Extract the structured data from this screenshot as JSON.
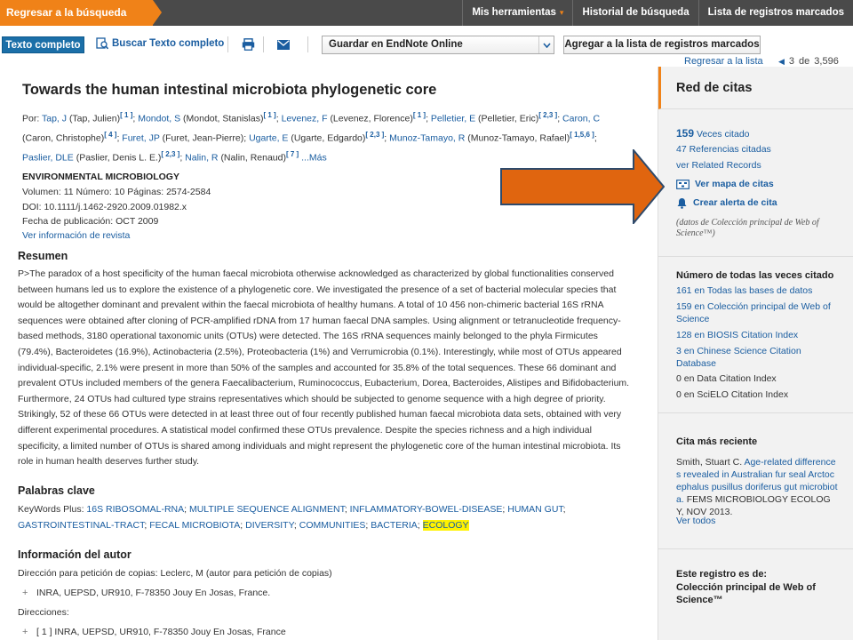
{
  "topbar": {
    "back_label": "Regresar a la búsqueda",
    "nav": [
      {
        "label": "Mis herramientas",
        "caret": "▾"
      },
      {
        "label": "Historial de búsqueda"
      },
      {
        "label": "Lista de registros marcados"
      }
    ]
  },
  "toolbar": {
    "fulltext_label": "Texto completo",
    "find_fulltext_label": "Buscar Texto completo",
    "print_icon": "print-icon",
    "email_icon": "email-icon",
    "endnote_value": "Guardar en EndNote Online",
    "add_marked_label": "Agregar a la lista de registros marcados"
  },
  "navline": {
    "return_label": "Regresar a la lista",
    "current": "3",
    "of": "de",
    "total": "3,596"
  },
  "record": {
    "title": "Towards the human intestinal microbiota phylogenetic core",
    "by_label": "Por:",
    "authors_line1": [
      {
        "short": "Tap, J",
        "full": "(Tap, Julien)",
        "ref": "[ 1 ]"
      },
      {
        "short": "Mondot, S",
        "full": "(Mondot, Stanislas)",
        "ref": "[ 1 ]"
      },
      {
        "short": "Levenez, F",
        "full": "(Levenez, Florence)",
        "ref": "[ 1 ]"
      },
      {
        "short": "Pelletier, E",
        "full": "(Pelletier, Eric)",
        "ref": "[ 2,3 ]"
      },
      {
        "short": "Caron, C",
        "full": "",
        "ref": ""
      }
    ],
    "authors_line2_prefix": "(Caron, Christophe)",
    "authors_line2_prefix_ref": "[ 4 ]",
    "authors_line2": [
      {
        "short": "Furet, JP",
        "full": "(Furet, Jean-Pierre)",
        "ref": ""
      },
      {
        "short": "Ugarte, E",
        "full": "(Ugarte, Edgardo)",
        "ref": "[ 2,3 ]"
      },
      {
        "short": "Munoz-Tamayo, R",
        "full": "(Munoz-Tamayo, Rafael)",
        "ref": "[ 1,5,6 ]"
      }
    ],
    "authors_line3": [
      {
        "short": "Paslier, DLE",
        "full": "(Paslier, Denis L. E.)",
        "ref": "[ 2,3 ]"
      },
      {
        "short": "Nalin, R",
        "full": "(Nalin, Renaud)",
        "ref": "[ 7 ]"
      }
    ],
    "more_label": "...Más",
    "journal": "ENVIRONMENTAL MICROBIOLOGY",
    "volume_line": "Volumen:  11   Número:  10   Páginas:  2574-2584",
    "doi_line": "DOI:  10.1111/j.1462-2920.2009.01982.x",
    "pubdate_line": "Fecha de publicación:  OCT 2009",
    "journal_info_link": "Ver información de revista",
    "abstract_heading": "Resumen",
    "abstract": "P>The paradox of a host specificity of the human faecal microbiota otherwise acknowledged as characterized by global functionalities conserved between humans led us to explore the existence of a phylogenetic core. We investigated the presence of a set of bacterial molecular species that would be altogether dominant and prevalent within the faecal microbiota of healthy humans. A total of 10 456 non-chimeric bacterial 16S rRNA sequences were obtained after cloning of PCR-amplified rDNA from 17 human faecal DNA samples. Using alignment or tetranucleotide frequency-based methods, 3180 operational taxonomic units (OTUs) were detected. The 16S rRNA sequences mainly belonged to the phyla Firmicutes (79.4%), Bacteroidetes (16.9%), Actinobacteria (2.5%), Proteobacteria (1%) and Verrumicrobia (0.1%). Interestingly, while most of OTUs appeared individual-specific, 2.1% were present in more than 50% of the samples and accounted for 35.8% of the total sequences. These 66 dominant and prevalent OTUs included members of the genera Faecalibacterium, Ruminococcus, Eubacterium, Dorea, Bacteroides, Alistipes and Bifidobacterium. Furthermore, 24 OTUs had cultured type strains representatives which should be subjected to genome sequence with a high degree of priority. Strikingly, 52 of these 66 OTUs were detected in at least three out of four recently published human faecal microbiota data sets, obtained with very different experimental procedures. A statistical model confirmed these OTUs prevalence. Despite the species richness and a high individual specificity, a limited number of OTUs is shared among individuals and might represent the phylogenetic core of the human intestinal microbiota. Its role in human health deserves further study.",
    "keywords_heading": "Palabras clave",
    "keywords_plus_label": "KeyWords Plus:",
    "keywords": [
      "16S RIBOSOMAL-RNA",
      "MULTIPLE SEQUENCE ALIGNMENT",
      "INFLAMMATORY-BOWEL-DISEASE",
      "HUMAN GUT",
      "GASTROINTESTINAL-TRACT",
      "FECAL MICROBIOTA",
      "DIVERSITY",
      "COMMUNITIES",
      "BACTERIA",
      "ECOLOGY"
    ],
    "highlighted_keyword": "ECOLOGY",
    "author_info_heading": "Información del autor",
    "reprint_line": "Dirección para petición de copias:  Leclerc, M (autor para petición de copias)",
    "reprint_address": "INRA, UEPSD, UR910, F-78350 Jouy En Josas, France.",
    "addresses_label": "Direcciones:",
    "address_1": "[ 1 ] INRA, UEPSD, UR910, F-78350 Jouy En Josas, France"
  },
  "right_panel": {
    "title": "Red de citas",
    "times_cited_count": "159",
    "times_cited_label": "Veces citado",
    "refs_label": "47 Referencias citadas",
    "related_label": "ver Related Records",
    "citation_map_label": "Ver mapa de citas",
    "citation_alert_label": "Crear alerta de cita",
    "source_note": "(datos de Colección principal de Web of Science™)",
    "all_times_heading": "Número de todas las veces citado",
    "counts": [
      {
        "text": "161 en Todas las bases de datos",
        "link": true
      },
      {
        "text": "159 en Colección principal de Web of Science",
        "link": true
      },
      {
        "text": "128 en BIOSIS Citation Index",
        "link": true
      },
      {
        "text": "3 en Chinese Science Citation Database",
        "link": true
      },
      {
        "text": "0 en Data Citation Index",
        "link": false
      },
      {
        "text": "0 en SciELO Citation Index",
        "link": false
      }
    ],
    "recent_heading": "Cita más reciente",
    "recent_author": "Smith, Stuart C.",
    "recent_title": "Age-related differences revealed in Australian fur seal Arctocephalus pusillus doriferus gut microbiota.",
    "recent_source": "FEMS MICROBIOLOGY ECOLOGY, NOV 2013.",
    "view_all_label": "Ver todos",
    "record_from_label": "Este registro es de:",
    "record_from_value": "Colección principal de Web of Science™"
  },
  "colors": {
    "accent_orange": "#f08218",
    "topbar_bg": "#4a4a4a",
    "link_blue": "#1a5da0",
    "button_blue": "#1b6fa8",
    "highlight": "#fff200",
    "arrow_fill": "#e0650f",
    "arrow_stroke": "#2e4a6b"
  }
}
